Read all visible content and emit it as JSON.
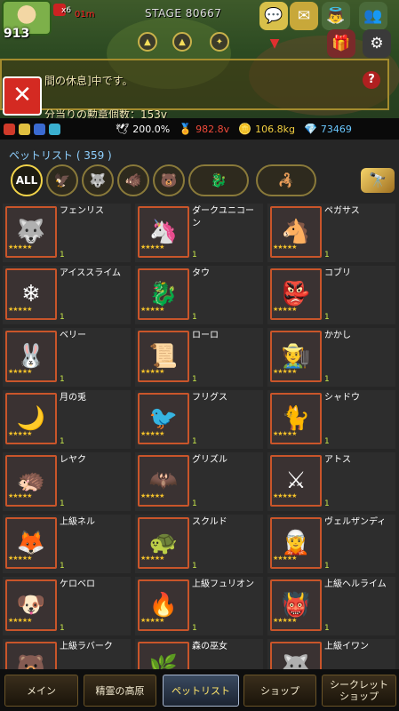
{
  "top_bar": {
    "level": "913",
    "multiplier": "x6",
    "multiplier_time": "01m",
    "stage": "STAGE 80667",
    "notice": "間の休息]中です。",
    "medal_rate": "分当りの勲章個数：153v",
    "help": "?",
    "close": "✕"
  },
  "status": {
    "percent": "200.0%",
    "medals": "982.8v",
    "weight": "106.8kg",
    "gems": "73469"
  },
  "list": {
    "title": "ペットリスト ( 359 )",
    "filter_all": "ALL"
  },
  "pets": [
    {
      "name": "フェンリス",
      "count": "1",
      "icon": "🐺"
    },
    {
      "name": "ダークユニコーン",
      "count": "1",
      "icon": "🦄"
    },
    {
      "name": "ペガサス",
      "count": "1",
      "icon": "🐴"
    },
    {
      "name": "アイススライム",
      "count": "1",
      "icon": "❄"
    },
    {
      "name": "タウ",
      "count": "1",
      "icon": "🐉"
    },
    {
      "name": "コブリ",
      "count": "1",
      "icon": "👺"
    },
    {
      "name": "ベリー",
      "count": "1",
      "icon": "🐰"
    },
    {
      "name": "ローロ",
      "count": "1",
      "icon": "📜"
    },
    {
      "name": "かかし",
      "count": "1",
      "icon": "🧑‍🌾"
    },
    {
      "name": "月の兎",
      "count": "1",
      "icon": "🌙"
    },
    {
      "name": "フリグス",
      "count": "1",
      "icon": "🐦"
    },
    {
      "name": "シャドウ",
      "count": "1",
      "icon": "🐈"
    },
    {
      "name": "レヤク",
      "count": "1",
      "icon": "🦔"
    },
    {
      "name": "グリズル",
      "count": "1",
      "icon": "🦇"
    },
    {
      "name": "アトス",
      "count": "1",
      "icon": "⚔"
    },
    {
      "name": "上級ネル",
      "count": "1",
      "icon": "🦊"
    },
    {
      "name": "スクルド",
      "count": "1",
      "icon": "🐢"
    },
    {
      "name": "ヴェルザンディ",
      "count": "1",
      "icon": "🧝"
    },
    {
      "name": "ケロベロ",
      "count": "1",
      "icon": "🐶"
    },
    {
      "name": "上級フュリオン",
      "count": "1",
      "icon": "🔥"
    },
    {
      "name": "上級ヘルライム",
      "count": "1",
      "icon": "👹"
    },
    {
      "name": "上級ラバーク",
      "count": "",
      "icon": "🐻"
    },
    {
      "name": "森の巫女",
      "count": "",
      "icon": "🌿"
    },
    {
      "name": "上級イワン",
      "count": "",
      "icon": "🐺"
    }
  ],
  "nav": {
    "main": "メイン",
    "plateau": "精霊の高原",
    "pet_list": "ペットリスト",
    "shop": "ショップ",
    "secret_shop": "シークレット\nショップ"
  },
  "colors": {
    "accent": "#f4c22a",
    "close_red": "#d42a22",
    "portrait_border": "#c9552a",
    "active_nav_text": "#ffe56a"
  }
}
